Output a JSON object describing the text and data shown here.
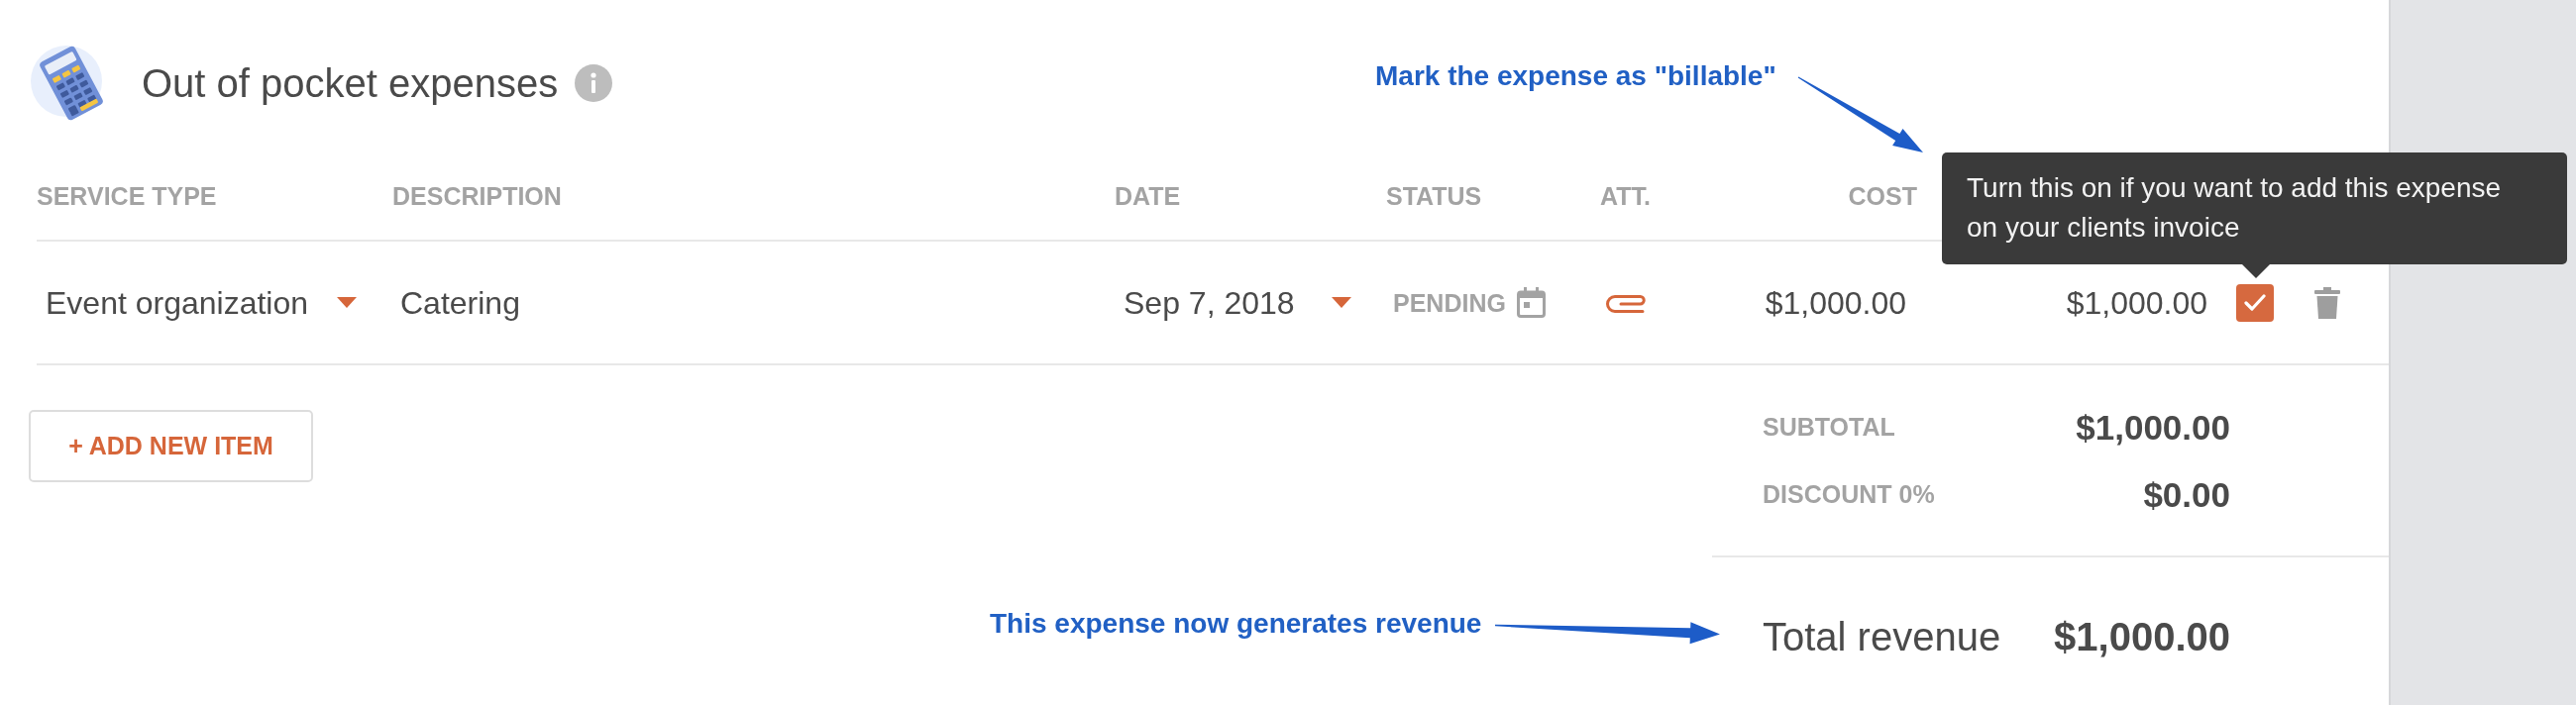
{
  "section": {
    "title": "Out of pocket expenses"
  },
  "table": {
    "columns": [
      "SERVICE TYPE",
      "DESCRIPTION",
      "DATE",
      "STATUS",
      "ATT.",
      "COST"
    ],
    "rows": [
      {
        "service_type": "Event organization",
        "description": "Catering",
        "date": "Sep 7, 2018",
        "status": "PENDING",
        "cost": "$1,000.00",
        "column_7": "$1,000.00",
        "checked": true
      }
    ]
  },
  "tooltip": {
    "text": "Turn this on if you want to add this expense on your clients invoice"
  },
  "add_button": {
    "label": "+ ADD NEW ITEM"
  },
  "summary": {
    "rows": [
      {
        "label": "SUBTOTAL",
        "value": "$1,000.00"
      },
      {
        "label": "DISCOUNT 0%",
        "value": "$0.00"
      }
    ],
    "total": {
      "label": "Total revenue",
      "value": "$1,000.00"
    }
  },
  "annotations": [
    {
      "text": "Mark the expense as \"billable\""
    },
    {
      "text": "This expense now generates revenue"
    }
  ]
}
